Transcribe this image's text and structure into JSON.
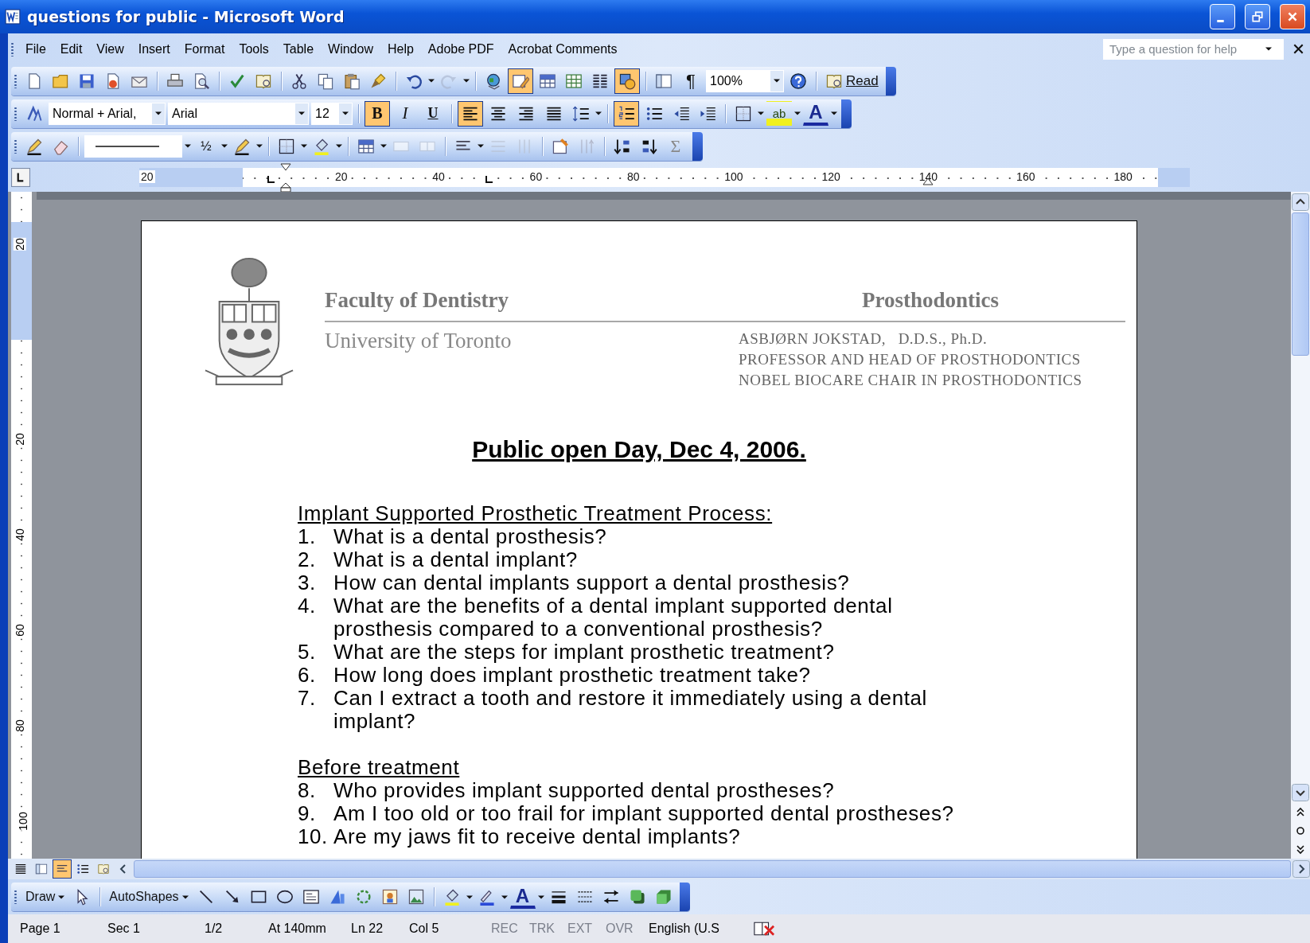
{
  "window": {
    "title": "questions for public - Microsoft Word"
  },
  "menu_bar": {
    "items": [
      "File",
      "Edit",
      "View",
      "Insert",
      "Format",
      "Tools",
      "Table",
      "Window",
      "Help",
      "Adobe PDF",
      "Acrobat Comments"
    ],
    "help_box": {
      "placeholder": "Type a question for help"
    }
  },
  "standard_toolbar": {
    "tables_and_borders": {
      "on": true
    },
    "drawing": {
      "on": true
    },
    "show_formatting": "¶",
    "zoom": "100%",
    "read": "Read"
  },
  "formatting_toolbar": {
    "style": "Normal + Arial,",
    "font": "Arial",
    "size": "12",
    "bold": {
      "label": "B",
      "on": true
    },
    "italic": {
      "label": "I",
      "on": false
    },
    "underline": {
      "label": "U",
      "on": false
    },
    "alignment": [
      {
        "selected": true
      },
      {
        "selected": false
      },
      {
        "selected": false
      },
      {
        "selected": false
      }
    ],
    "numbering": {
      "on": true
    },
    "bullets": {
      "on": false
    },
    "highlight": "ab",
    "font_color": "A"
  },
  "tables_toolbar": {
    "line_weight": "½",
    "autosum": "Σ"
  },
  "ruler": {
    "horizontal": [
      "20",
      "20",
      "40",
      "60",
      "80",
      "100",
      "120",
      "140",
      "160",
      "180"
    ],
    "vertical": [
      "20",
      "20",
      "40",
      "60",
      "80",
      "100"
    ]
  },
  "document": {
    "letterhead": {
      "faculty": "Faculty of Dentistry",
      "department": "Prosthodontics",
      "university": "University of Toronto",
      "contact_lines": [
        "ASBJØRN JOKSTAD,   D.D.S., Ph.D.",
        "PROFESSOR AND HEAD OF PROSTHODONTICS",
        "NOBEL BIOCARE CHAIR IN PROSTHODONTICS"
      ]
    },
    "title": "Public open Day, Dec 4, 2006.",
    "sections": [
      {
        "heading": "Implant Supported Prosthetic Treatment Process:",
        "items": [
          {
            "number": "1.",
            "text": "What is a dental prosthesis?"
          },
          {
            "number": "2.",
            "text": "What is a dental implant?"
          },
          {
            "number": "3.",
            "text": "How can dental implants support a dental prosthesis?"
          },
          {
            "number": "4.",
            "text": "What are the benefits of a dental implant supported dental prosthesis compared to a conventional prosthesis?"
          },
          {
            "number": "5.",
            "text": "What are the steps for implant prosthetic treatment?"
          },
          {
            "number": "6.",
            "text": "How long does implant prosthetic treatment take?"
          },
          {
            "number": "7.",
            "text": "Can I extract a tooth and restore it immediately using a dental implant?"
          }
        ]
      },
      {
        "heading": "Before treatment",
        "items": [
          {
            "number": "8.",
            "text": "Who provides implant supported dental prostheses?"
          },
          {
            "number": "9.",
            "text": "Am I too old or too frail for implant supported dental prostheses?"
          },
          {
            "number": "10.",
            "text": "Are my jaws fit to receive dental implants?"
          }
        ]
      }
    ]
  },
  "view_buttons": [
    {
      "selected": false
    },
    {
      "selected": false
    },
    {
      "selected": true
    },
    {
      "selected": false
    },
    {
      "selected": false
    }
  ],
  "drawing_toolbar": {
    "draw": "Draw",
    "autoshapes": "AutoShapes",
    "font_color": "A"
  },
  "status_bar": {
    "items": [
      "Page 1",
      "Sec 1",
      "1/2",
      "At 140mm",
      "Ln 22",
      "Col 5"
    ],
    "modes": [
      {
        "label": "REC",
        "disabled": true
      },
      {
        "label": "TRK",
        "disabled": true
      },
      {
        "label": "EXT",
        "disabled": true
      },
      {
        "label": "OVR",
        "disabled": true
      }
    ],
    "language": "English (U.S"
  }
}
